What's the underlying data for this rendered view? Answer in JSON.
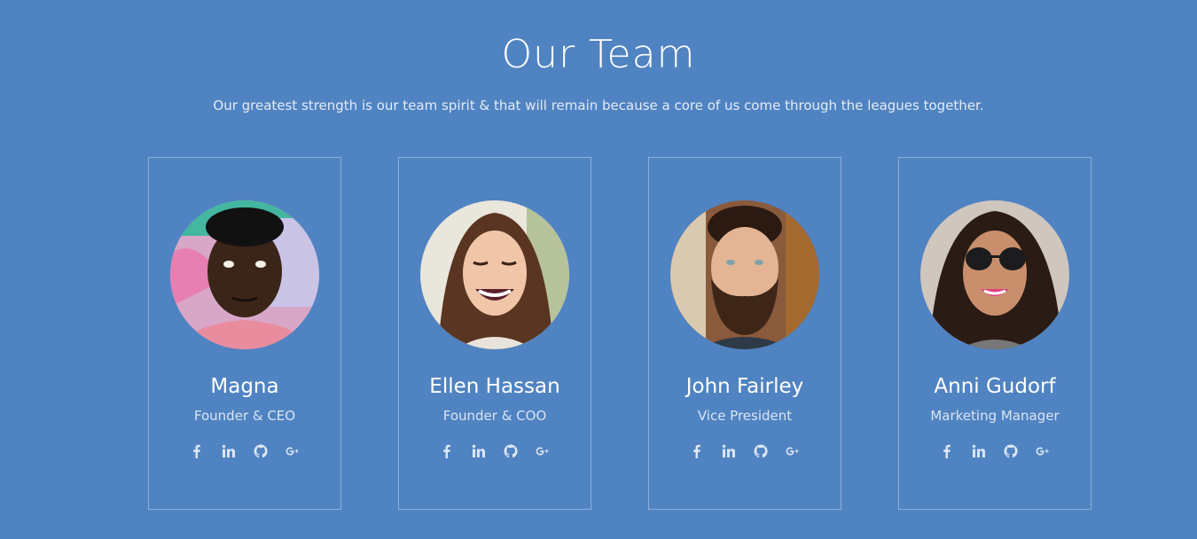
{
  "section": {
    "title": "Our Team",
    "subtitle": "Our greatest strength is our team spirit & that will remain because a core of us come through the leagues together."
  },
  "members": [
    {
      "name": "Magna",
      "role": "Founder & CEO"
    },
    {
      "name": "Ellen Hassan",
      "role": "Founder & COO"
    },
    {
      "name": "John Fairley",
      "role": "Vice President"
    },
    {
      "name": "Anni Gudorf",
      "role": "Marketing Manager"
    }
  ],
  "social_icons": [
    "facebook-icon",
    "linkedin-icon",
    "github-icon",
    "google-plus-icon"
  ],
  "colors": {
    "background": "#5083c1",
    "card_border": "#8fb0da",
    "text": "#ffffff",
    "muted_text": "#d8e4f3"
  }
}
